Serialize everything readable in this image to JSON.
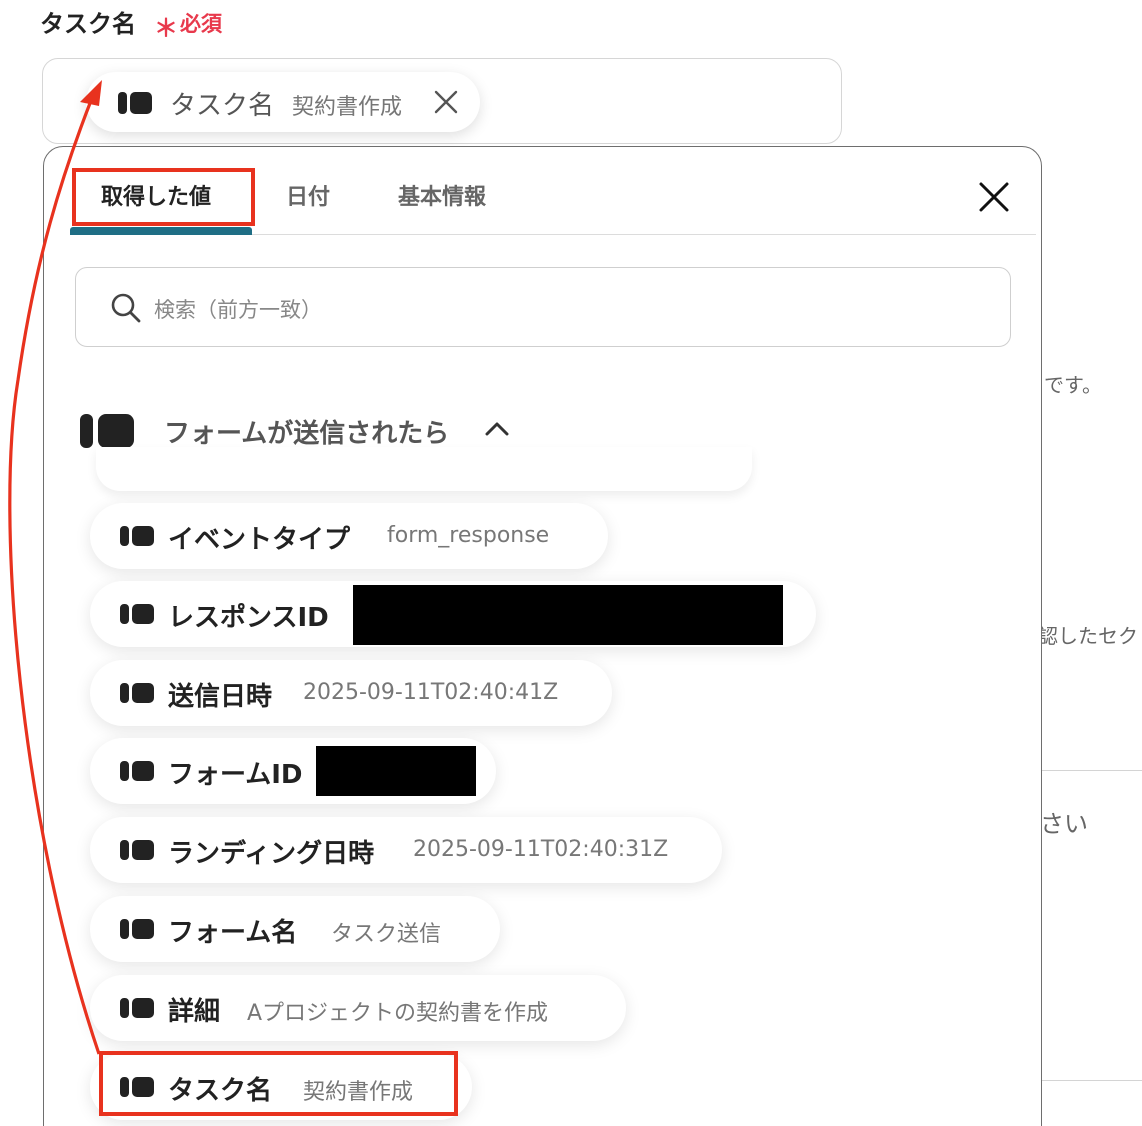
{
  "field": {
    "label": "タスク名",
    "required_mark": "＊",
    "required_text": "必須"
  },
  "selected_chip": {
    "key": "タスク名",
    "value": "契約書作成",
    "icon": "data-tag-icon",
    "remove_icon": "close-icon"
  },
  "background_text": {
    "line1": "です。",
    "line2": "認したセク",
    "line3": "さい"
  },
  "tabs": [
    {
      "label": "取得した値",
      "active": true
    },
    {
      "label": "日付",
      "active": false
    },
    {
      "label": "基本情報",
      "active": false
    }
  ],
  "search": {
    "placeholder": "検索（前方一致）"
  },
  "group": {
    "title": "フォームが送信されたら",
    "expanded": true
  },
  "items": [
    {
      "key": "イベントタイプ",
      "value": "form_response"
    },
    {
      "key": "レスポンスID",
      "value": "",
      "redacted": true
    },
    {
      "key": "送信日時",
      "value": "2025-09-11T02:40:41Z"
    },
    {
      "key": "フォームID",
      "value": "",
      "redacted": true
    },
    {
      "key": "ランディング日時",
      "value": "2025-09-11T02:40:31Z"
    },
    {
      "key": "フォーム名",
      "value": "タスク送信"
    },
    {
      "key": "詳細",
      "value": "Aプロジェクトの契約書を作成"
    },
    {
      "key": "タスク名",
      "value": "契約書作成"
    }
  ],
  "colors": {
    "required": "#e8394c",
    "tab_underline": "#1f6e85",
    "annotation": "#e8321e",
    "redaction": "#000000"
  }
}
